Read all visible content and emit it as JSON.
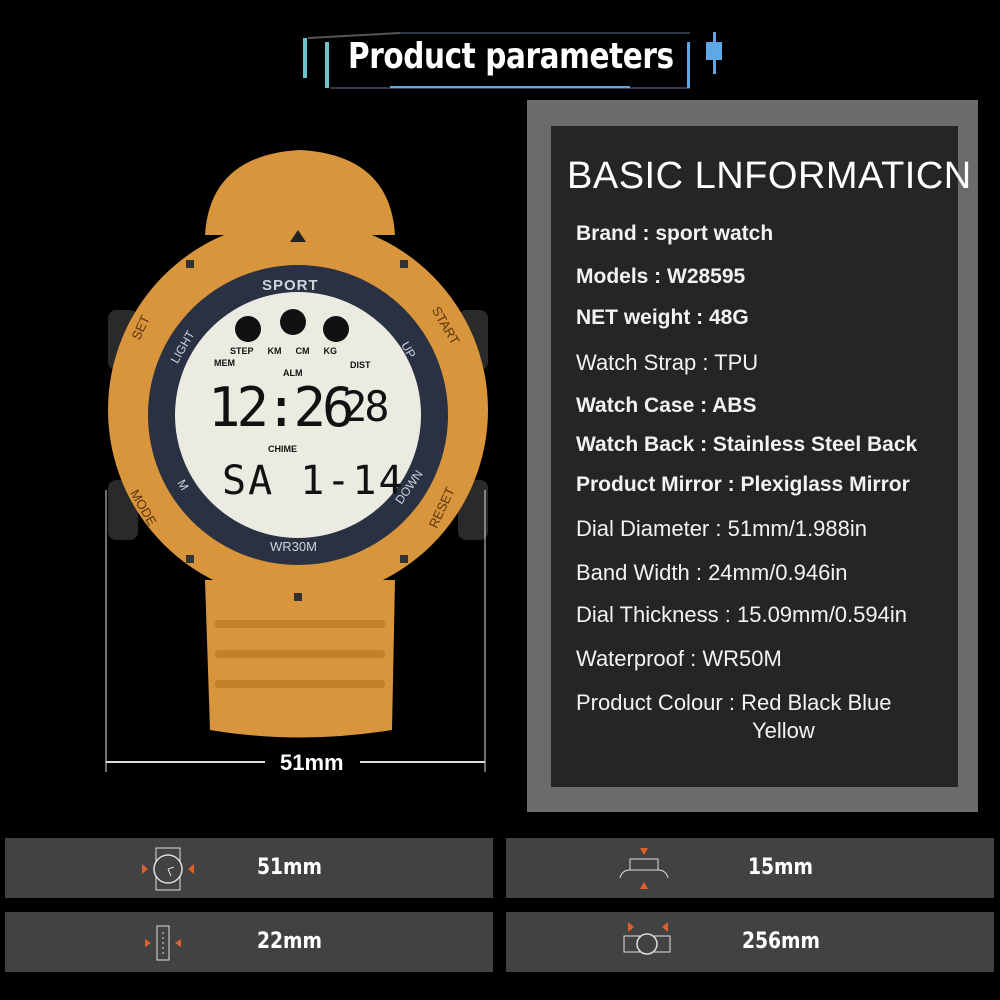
{
  "header": {
    "title": "Product parameters",
    "accent": "#5fa8e6"
  },
  "watch": {
    "body_color": "#d8953c",
    "bezel_labels": {
      "top": "SPORT",
      "bottom": "WR30M",
      "left_upper": "LIGHT",
      "left_lower": "M",
      "right_upper": "UP",
      "right_lower": "DOWN"
    },
    "button_labels": {
      "set": "SET",
      "start": "START",
      "mode": "MODE",
      "reset": "RESET"
    },
    "lcd": {
      "indicators_top": [
        "STEP",
        "KM",
        "CM",
        "KG"
      ],
      "mem": "MEM",
      "dist": "DIST",
      "alm": "ALM",
      "chime": "CHIME",
      "time": "12:26",
      "seconds": "28",
      "date": "SA 1-14"
    }
  },
  "dimension": {
    "label": "51mm"
  },
  "info": {
    "title": "BASIC LNFORMATICN",
    "rows": [
      "Brand :  sport watch",
      "Models :  W28595",
      "NET weight :  48G",
      "Watch Strap : TPU",
      "Watch Case : ABS",
      "Watch Back : Stainless Steel Back",
      "Product Mirror : Plexiglass Mirror",
      "Dial Diameter : 51mm/1.988in",
      "Band Width : 24mm/0.946in",
      "Dial Thickness : 15.09mm/0.594in",
      "Waterproof : WR50M",
      "Product Colour : Red Black Blue",
      "Yellow"
    ]
  },
  "specs": [
    {
      "icon": "dial-diameter-icon",
      "value": "51mm"
    },
    {
      "icon": "thickness-icon",
      "value": "15mm"
    },
    {
      "icon": "band-width-icon",
      "value": "22mm"
    },
    {
      "icon": "strap-length-icon",
      "value": "256mm"
    }
  ],
  "colors": {
    "arrow": "#e0602a",
    "card": "#424242",
    "panel": "#6b6b6b"
  }
}
